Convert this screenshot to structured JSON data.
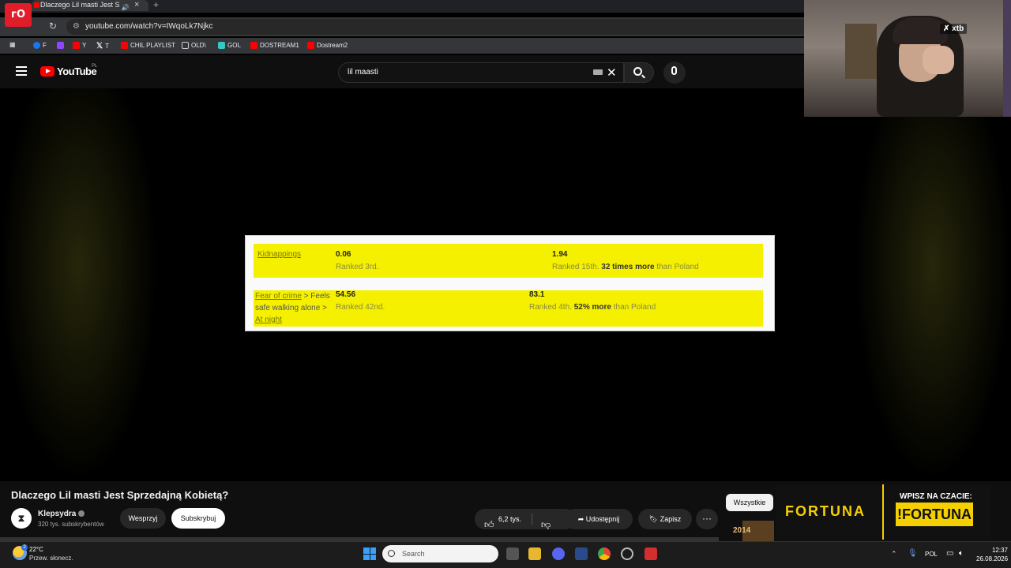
{
  "browser": {
    "tab_title": "Dlaczego Lil masti Jest Sprz",
    "tab_close": "×",
    "new_tab": "+",
    "url": "youtube.com/watch?v=IWqoLk7Njkc",
    "bookmarks": [
      {
        "label": "F",
        "icon": "facebook-icon",
        "color": "#1877f2"
      },
      {
        "label": "",
        "icon": "twitch-icon",
        "color": "#9146ff"
      },
      {
        "label": "Y",
        "icon": "youtube-icon",
        "color": "#ff0000"
      },
      {
        "label": "T",
        "icon": "x-icon",
        "color": "#ffffff"
      },
      {
        "label": "CHIL PLAYLIST",
        "icon": "youtube-icon",
        "color": "#ff0000"
      },
      {
        "label": "OLD\\",
        "icon": "folder-icon",
        "color": "#cccccc"
      },
      {
        "label": "GOL",
        "icon": "gol-icon",
        "color": "#33c9c9"
      },
      {
        "label": "DOSTREAM1",
        "icon": "youtube-icon",
        "color": "#ff0000"
      },
      {
        "label": "Dostream2",
        "icon": "youtube-icon",
        "color": "#ff0000"
      }
    ]
  },
  "youtube": {
    "logo": "YouTube",
    "region": "PL",
    "search_query": "lil maasti"
  },
  "video_frame": {
    "row1": {
      "label": "Kidnappings",
      "value_a": "0.06",
      "rank_a": "Ranked 3rd.",
      "value_b": "1.94",
      "rank_b_prefix": "Ranked 15th.",
      "rank_b_bold": "32 times more",
      "rank_b_suffix": "than Poland"
    },
    "row2": {
      "label_link": "Fear of crime",
      "label_rest": " > Feels safe walking alone > ",
      "label_link2": "At night",
      "value_a": "54.56",
      "rank_a": "Ranked 42nd.",
      "value_b": "83.1",
      "rank_b_prefix": "Ranked 4th.",
      "rank_b_bold": "52% more",
      "rank_b_suffix": "than Poland"
    }
  },
  "video": {
    "title": "Dlaczego Lil masti Jest Sprzedajną Kobietą?",
    "channel": "Klepsydra",
    "subscribers": "320 tys. subskrybentów",
    "support_label": "Wesprzyj",
    "subscribe_label": "Subskrybuj",
    "likes": "6,2 tys.",
    "share_label": "Udostępnij",
    "save_label": "Zapisz",
    "more_label": "···",
    "filter_chip": "Wszystkie",
    "year_label": "2014"
  },
  "ad": {
    "brand": "FORTUNA",
    "call": "WPISZ NA CZACIE:",
    "tag": "!FORTUNA"
  },
  "webcam": {
    "badge": "xtb"
  },
  "taskbar": {
    "temperature": "22°C",
    "weather": "Przew. słonecz.",
    "weather_badge": "2",
    "search_placeholder": "Search",
    "language": "POL",
    "time": "12:37",
    "date": "26.08.2026"
  },
  "colors": {
    "yellow_highlight": "#f5f000",
    "youtube_red": "#ff0000",
    "fortuna_yellow": "#f5d000"
  }
}
